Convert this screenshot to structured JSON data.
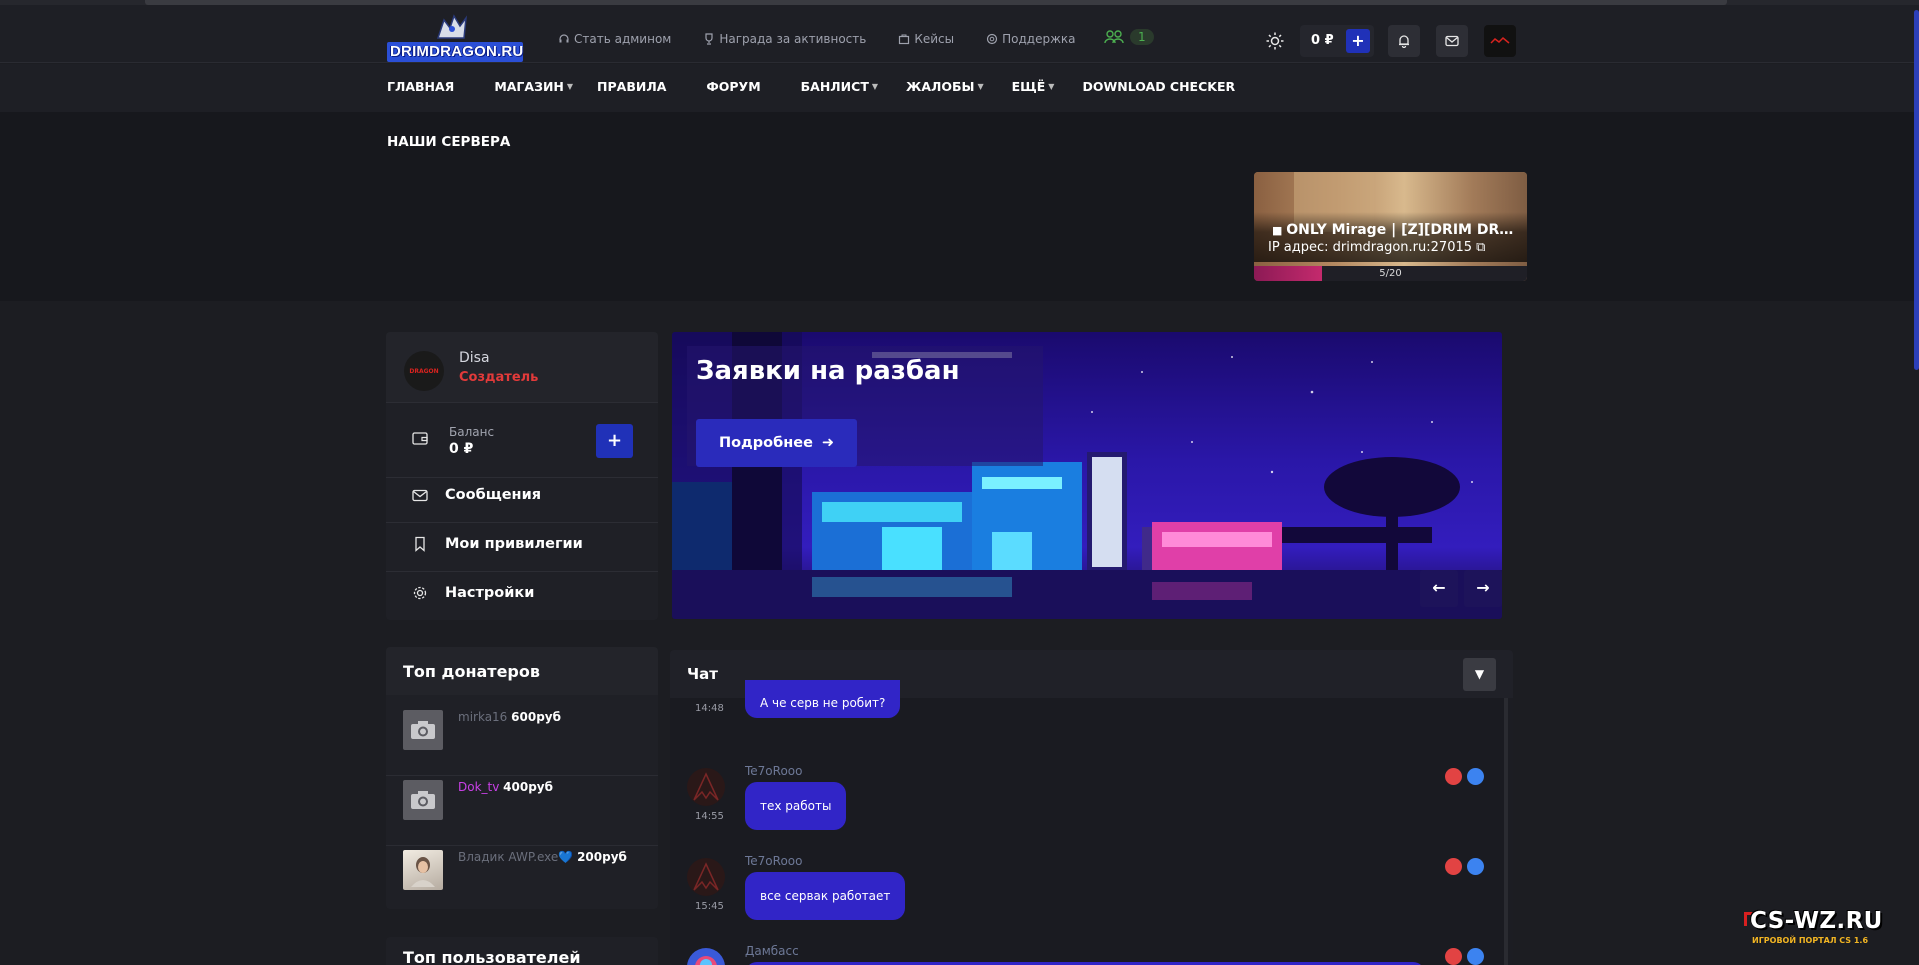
{
  "header": {
    "logo_text": "DRIMDRAGON.RU",
    "links": [
      {
        "label": "Стать админом",
        "icon": "headset-icon"
      },
      {
        "label": "Награда за активность",
        "icon": "trophy-icon"
      },
      {
        "label": "Кейсы",
        "icon": "box-icon"
      },
      {
        "label": "Поддержка",
        "icon": "support-icon"
      }
    ],
    "online_count": "1",
    "balance": "0 ₽",
    "balance_plus": "+"
  },
  "nav": {
    "items": [
      {
        "label": "ГЛАВНАЯ",
        "dropdown": false
      },
      {
        "label": "МАГАЗИН",
        "dropdown": true
      },
      {
        "label": "ПРАВИЛА",
        "dropdown": false
      },
      {
        "label": "ФОРУМ",
        "dropdown": false
      },
      {
        "label": "БАНЛИСТ",
        "dropdown": true
      },
      {
        "label": "ЖАЛОБЫ",
        "dropdown": true
      },
      {
        "label": "ЕЩЁ",
        "dropdown": true
      },
      {
        "label": "DOWNLOAD CHECKER",
        "dropdown": false
      }
    ]
  },
  "servers": {
    "title": "НАШИ СЕРВЕРА",
    "card": {
      "name": "ONLY Mirage | [Z][DRIM DRAGON]",
      "ip": "IP адрес: drimdragon.ru:27015",
      "players": "5/20",
      "fill_fraction": 0.25
    }
  },
  "profile": {
    "avatar_text": "DRAGON",
    "username": "Disa",
    "role": "Создатель",
    "balance_label": "Баланс",
    "balance_value": "0 ₽",
    "plus": "+",
    "menu": [
      {
        "label": "Сообщения",
        "icon": "envelope-icon"
      },
      {
        "label": "Мои привилегии",
        "icon": "bookmark-icon"
      },
      {
        "label": "Настройки",
        "icon": "gear-icon"
      }
    ]
  },
  "banner": {
    "title": "Заявки на разбан",
    "button": "Подробнее",
    "prev": "←",
    "next": "→"
  },
  "donors": {
    "title": "Топ донатеров",
    "items": [
      {
        "name": "mirka16",
        "amount": "600руб",
        "color": "#6b6f7c"
      },
      {
        "name": "Dok_tv",
        "amount": "400руб",
        "color": "#c940e6"
      },
      {
        "name": "Владик AWP.exe💙",
        "amount": "200руб",
        "color": "#6b6f7c"
      }
    ]
  },
  "top_users": {
    "title": "Топ пользователей"
  },
  "chat": {
    "title": "Чат",
    "messages": [
      {
        "author": "",
        "time": "14:48",
        "text": "А че серв не робит?"
      },
      {
        "author": "Te7oRooo",
        "time": "14:55",
        "text": "тех работы"
      },
      {
        "author": "Te7oRooo",
        "time": "15:45",
        "text": "все сервак работает"
      },
      {
        "author": "Дамбасс",
        "time": "",
        "text": ""
      }
    ]
  },
  "watermark": {
    "big": "CS-WZ.RU",
    "small": "ИГРОВОЙ ПОРТАЛ CS 1.6"
  }
}
